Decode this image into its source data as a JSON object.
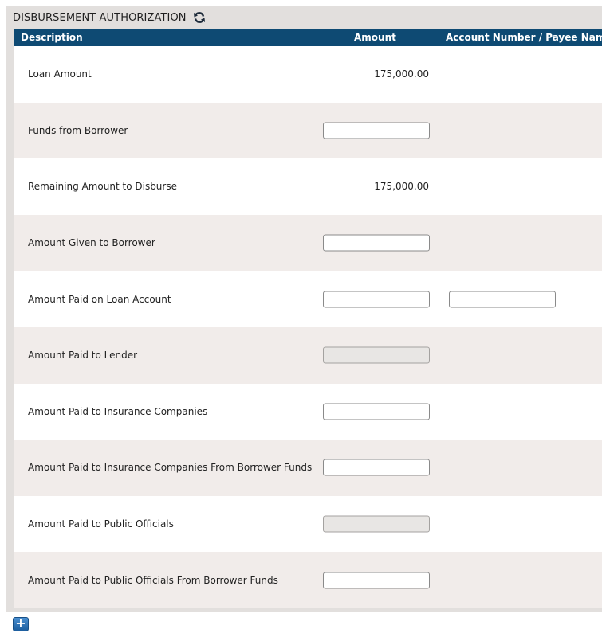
{
  "panel": {
    "title": "DISBURSEMENT AUTHORIZATION",
    "refresh_icon": "refresh-icon"
  },
  "table": {
    "headers": {
      "description": "Description",
      "amount": "Amount",
      "account": "Account Number / Payee Name"
    },
    "rows": [
      {
        "label": "Loan Amount",
        "value": "175,000.00",
        "input": "none",
        "account_input": false
      },
      {
        "label": "Funds from Borrower",
        "value": "",
        "input": "editable",
        "account_input": false
      },
      {
        "label": "Remaining Amount to Disburse",
        "value": "175,000.00",
        "input": "none",
        "account_input": false
      },
      {
        "label": "Amount Given to Borrower",
        "value": "",
        "input": "editable",
        "account_input": false
      },
      {
        "label": "Amount Paid on Loan Account",
        "value": "",
        "input": "editable",
        "account_input": true
      },
      {
        "label": "Amount Paid to Lender",
        "value": "",
        "input": "disabled",
        "account_input": false
      },
      {
        "label": "Amount Paid to Insurance Companies",
        "value": "",
        "input": "editable",
        "account_input": false
      },
      {
        "label": "Amount Paid to Insurance Companies From Borrower Funds",
        "value": "",
        "input": "editable",
        "account_input": false
      },
      {
        "label": "Amount Paid to Public Officials",
        "value": "",
        "input": "disabled",
        "account_input": false
      },
      {
        "label": "Amount Paid to Public Officials From Borrower Funds",
        "value": "",
        "input": "editable",
        "account_input": false
      }
    ]
  },
  "footer": {
    "add_label": "+",
    "add_icon": "plus-icon"
  },
  "colors": {
    "header_bg": "#0e4a73",
    "row_alt_bg": "#f1ecea",
    "panel_bg": "#e2dfdd",
    "add_button": "#1c5e9f"
  }
}
